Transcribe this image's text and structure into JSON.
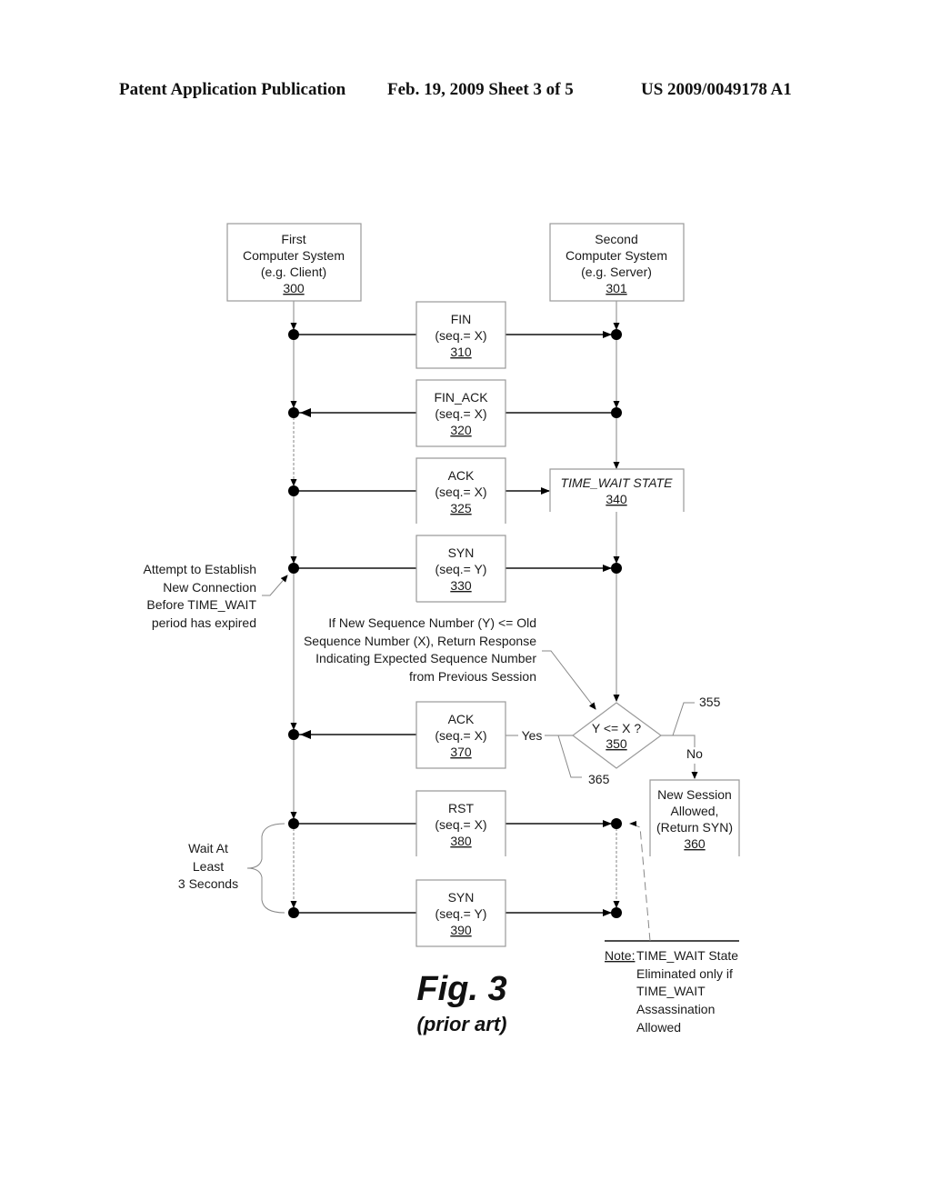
{
  "header": {
    "publication": "Patent Application Publication",
    "date_sheet": "Feb. 19, 2009   Sheet 3 of 5",
    "number": "US 2009/0049178 A1"
  },
  "systems": {
    "client": {
      "lines": [
        "First",
        "Computer System",
        "(e.g. Client)"
      ],
      "ref": "300"
    },
    "server": {
      "lines": [
        "Second",
        "Computer System",
        "(e.g. Server)"
      ],
      "ref": "301"
    }
  },
  "messages": [
    {
      "id": "fin",
      "label": "FIN",
      "seq": "(seq.= X)",
      "ref": "310",
      "direction": "to-server"
    },
    {
      "id": "fin-ack",
      "label": "FIN_ACK",
      "seq": "(seq.= X)",
      "ref": "320",
      "direction": "to-client"
    },
    {
      "id": "ack",
      "label": "ACK",
      "seq": "(seq.= X)",
      "ref": "325",
      "direction": "to-server"
    },
    {
      "id": "syn",
      "label": "SYN",
      "seq": "(seq.= Y)",
      "ref": "330",
      "direction": "to-server"
    },
    {
      "id": "ack2",
      "label": "ACK",
      "seq": "(seq.= X)",
      "ref": "370",
      "direction": "to-client"
    },
    {
      "id": "rst",
      "label": "RST",
      "seq": "(seq.= X)",
      "ref": "380",
      "direction": "to-server"
    },
    {
      "id": "syn2",
      "label": "SYN",
      "seq": "(seq.= Y)",
      "ref": "390",
      "direction": "to-server"
    }
  ],
  "time_wait": {
    "label": "TIME_WAIT STATE",
    "ref": "340"
  },
  "decision": {
    "label": "Y <= X ?",
    "ref": "350",
    "yes": "Yes",
    "no": "No",
    "ref_no_path": "355",
    "ref_yes_path": "365"
  },
  "new_session": {
    "lines": [
      "New Session",
      "Allowed,",
      "(Return SYN)"
    ],
    "ref": "360"
  },
  "annotations": {
    "attempt": [
      "Attempt to Establish",
      "New Connection",
      "Before TIME_WAIT",
      "period has expired"
    ],
    "condition": [
      "If New Sequence Number (Y) <= Old",
      "Sequence Number (X), Return Response",
      "Indicating Expected Sequence Number",
      "from Previous Session"
    ],
    "wait": [
      "Wait At",
      "Least",
      "3 Seconds"
    ],
    "note_label": "Note:",
    "note_text": [
      "TIME_WAIT State",
      "Eliminated only if",
      "TIME_WAIT",
      "Assassination",
      "Allowed"
    ]
  },
  "figure": {
    "title": "Fig. 3",
    "subtitle": "(prior art)"
  }
}
